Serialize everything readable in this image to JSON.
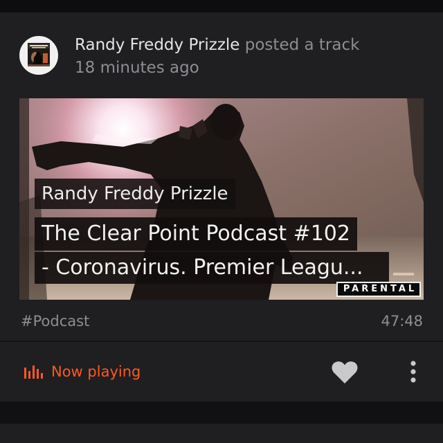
{
  "post": {
    "user_name": "Randy Freddy Prizzle",
    "action": "posted a track",
    "timestamp": "18 minutes ago",
    "avatar_icon": "album-cover-avatar"
  },
  "track": {
    "artwork_artist": "Randy Freddy Prizzle",
    "artwork_title_line1": "The Clear Point Podcast #102",
    "artwork_title_line2": "- Coronavirus. Premier Leagu...",
    "parental_label": "PARENTAL",
    "tag": "#Podcast",
    "duration": "47:48"
  },
  "actions": {
    "now_playing_label": "Now playing",
    "now_playing_icon": "equalizer-icon",
    "like_icon": "heart-icon",
    "more_icon": "more-vertical-icon"
  },
  "colors": {
    "accent": "#ff5a1f",
    "card_bg": "#1f1e21",
    "page_bg": "#111113",
    "primary_text": "#e4e4e4",
    "secondary_text": "#8e8d92",
    "icon_gray": "#c9c9cb"
  }
}
